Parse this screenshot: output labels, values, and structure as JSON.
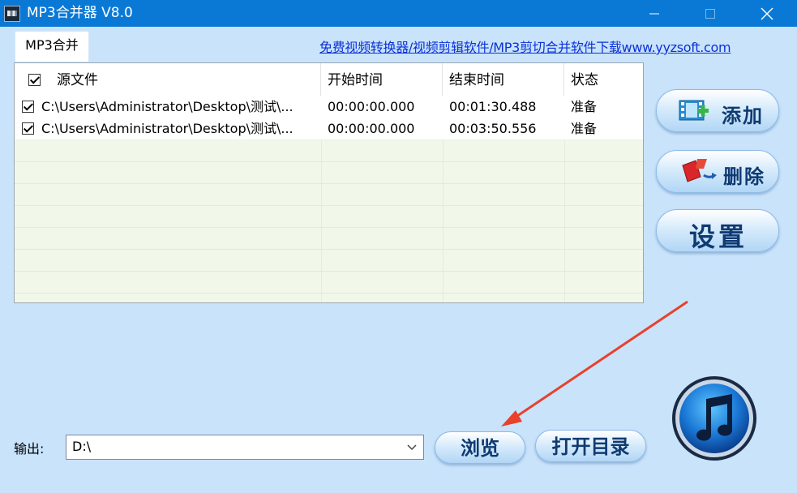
{
  "window": {
    "title": "MP3合并器 V8.0",
    "controls": [
      "minimize",
      "maximize",
      "close"
    ]
  },
  "tabs": [
    {
      "label": "MP3合并",
      "active": true
    }
  ],
  "top_link": "免费视频转换器/视频剪辑软件/MP3剪切合并软件下载www.yyzsoft.com",
  "table": {
    "columns": [
      "源文件",
      "开始时间",
      "结束时间",
      "状态"
    ],
    "header_checked": true,
    "rows": [
      {
        "checked": true,
        "file": "C:\\Users\\Administrator\\Desktop\\测试\\...",
        "start": "00:00:00.000",
        "end": "00:01:30.488",
        "status": "准备"
      },
      {
        "checked": true,
        "file": "C:\\Users\\Administrator\\Desktop\\测试\\...",
        "start": "00:00:00.000",
        "end": "00:03:50.556",
        "status": "准备"
      }
    ]
  },
  "side_buttons": {
    "add": "添加",
    "delete": "删除",
    "settings": "设置"
  },
  "output": {
    "label": "输出:",
    "value": "D:\\",
    "browse": "浏览",
    "open_dir": "打开目录"
  },
  "icons": {
    "add": "film-plus-icon",
    "delete": "delete-icon",
    "music": "music-note-icon",
    "app": "app-icon"
  },
  "colors": {
    "titlebar": "#0a79d6",
    "background": "#c9e3fb",
    "link": "#0b32d8",
    "button_text": "#0f3a72",
    "annotation_arrow": "#e8412c"
  }
}
